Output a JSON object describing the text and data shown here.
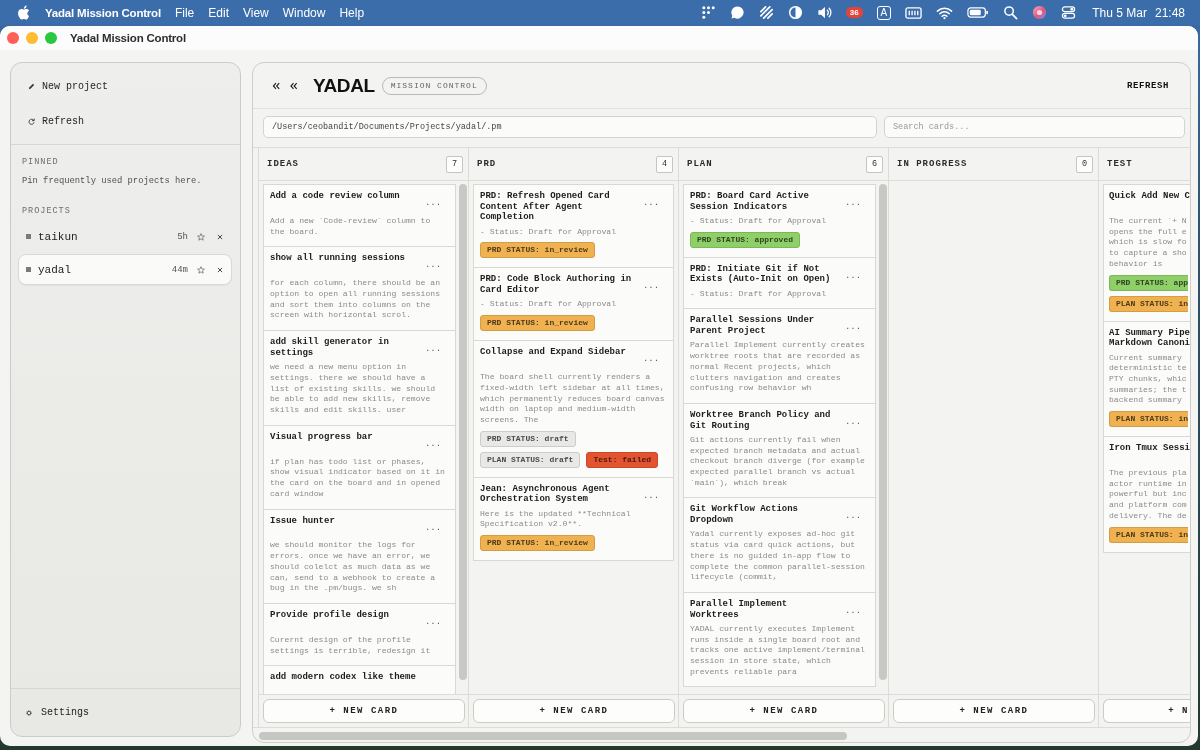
{
  "menubar": {
    "app": "Yadal Mission Control",
    "menus": [
      "File",
      "Edit",
      "View",
      "Window",
      "Help"
    ],
    "notification_count": "36",
    "input_source": "A",
    "date": "Thu 5 Mar",
    "time": "21:48"
  },
  "window": {
    "title": "Yadal Mission Control"
  },
  "sidebar": {
    "actions": [
      {
        "kind": "new",
        "label": "New project"
      },
      {
        "kind": "refresh",
        "label": "Refresh"
      }
    ],
    "pinned": {
      "heading": "PINNED",
      "empty_text": "Pin frequently used projects here."
    },
    "projects": {
      "heading": "PROJECTS",
      "items": [
        {
          "name": "taikun",
          "age": "5h",
          "starred": false,
          "selected": false
        },
        {
          "name": "yadal",
          "age": "44m",
          "starred": false,
          "selected": true
        }
      ]
    },
    "settings": "Settings"
  },
  "header": {
    "logo": "YADAL",
    "badge": "MISSION CONTROL",
    "refresh": "REFRESH",
    "path": {
      "value": "/Users/ceobandit/Documents/Projects/yadal/.pm"
    },
    "search": {
      "placeholder": "Search cards..."
    }
  },
  "columns": [
    {
      "title": "IDEAS",
      "count": "7",
      "scrollable": true,
      "new_card": "+ NEW CARD",
      "cards": [
        {
          "title": "Add a code review column",
          "menu": "...",
          "body": "Add a new `Code-review` column to the board."
        },
        {
          "title": "show all running sessions",
          "menu": "...",
          "body": "for each column, there should be an option to open all running sessions and sort them into columns on the screen with horizontal scrol."
        },
        {
          "title": "add skill generator in settings",
          "menu": "...",
          "body": "we need a new menu option in settings. there we should have a list of existing skills. we should be able to add new skills, remove skills and edit skills. user"
        },
        {
          "title": "Visual progress bar",
          "menu": "...",
          "body": "if plan has todo list or phases, show visual indicator based on it in the card on the board and in opened card window"
        },
        {
          "title": "Issue hunter",
          "menu": "...",
          "body": "we should monitor the logs for errors. once we have an error, we should colelct as much data as we can, send to a webhook to create a bug in the .pm/bugs. we sh"
        },
        {
          "title": "Provide profile design",
          "menu": "...",
          "body": "Curernt design of the profile settings is terrible, redesign it"
        },
        {
          "title": "add modern codex like theme"
        }
      ]
    },
    {
      "title": "PRD",
      "count": "4",
      "scrollable": false,
      "new_card": "+ NEW CARD",
      "cards": [
        {
          "title": "PRD: Refresh Opened Card Content After Agent Completion",
          "menu": "...",
          "body": "- Status: Draft for Approval",
          "badges": [
            {
              "text": "PRD STATUS: in_review",
              "color": "#f0b250"
            }
          ]
        },
        {
          "title": "PRD: Code Block Authoring in Card Editor",
          "menu": "...",
          "body": "- Status: Draft for Approval",
          "badges": [
            {
              "text": "PRD STATUS: in_review",
              "color": "#f0b250"
            }
          ]
        },
        {
          "title": "Collapse and Expand Sidebar",
          "menu": "...",
          "body": "The board shell currently renders a fixed-width left sidebar at all times, which permanently reduces board canvas width on laptop and medium-width screens. The",
          "badges": [
            {
              "text": "PRD STATUS: draft",
              "color": "#e8e8e6"
            },
            {
              "text": "PLAN STATUS: draft",
              "color": "#e8e8e6"
            },
            {
              "text": "Test: failed",
              "color": "#e3532f"
            }
          ]
        },
        {
          "title": "Jean: Asynchronous Agent Orchestration System",
          "menu": "...",
          "body": "Here is the updated **Technical Specification v2.0**.",
          "badges": [
            {
              "text": "PRD STATUS: in_review",
              "color": "#f0b250"
            }
          ]
        }
      ]
    },
    {
      "title": "PLAN",
      "count": "6",
      "scrollable": true,
      "new_card": "+ NEW CARD",
      "cards": [
        {
          "title": "PRD: Board Card Active Session Indicators",
          "menu": "...",
          "body": "- Status: Draft for Approval",
          "badges": [
            {
              "text": "PRD STATUS: approved",
              "color": "#8fcf68"
            }
          ]
        },
        {
          "title": "PRD: Initiate Git if Not Exists (Auto-Init on Open)",
          "menu": "...",
          "body": "- Status: Draft for Approval"
        },
        {
          "title": "Parallel Sessions Under Parent Project",
          "menu": "...",
          "body": "Parallel Implement currently creates worktree roots that are recorded as normal Recent projects, which clutters navigation and creates confusing row behavior wh"
        },
        {
          "title": "Worktree Branch Policy and Git Routing",
          "menu": "...",
          "body": "Git actions currently fail when expected branch metadata and actual checkout branch diverge (for example expected parallel branch vs actual `main`), which break"
        },
        {
          "title": "Git Workflow Actions Dropdown",
          "menu": "...",
          "body": "Yadal currently exposes ad-hoc git status via card quick actions, but there is no guided in-app flow to complete the common parallel-session lifecycle (commit,"
        },
        {
          "title": "Parallel Implement Worktrees",
          "menu": "...",
          "body": "YADAL currently executes Implement runs inside a single board root and tracks one active implement/terminal session in store state, which prevents reliable para"
        }
      ]
    },
    {
      "title": "IN PROGRESS",
      "count": "0",
      "scrollable": false,
      "new_card": "+ NEW CARD"
    },
    {
      "title": "TEST",
      "scrollable": false,
      "new_card": "+ N",
      "cards": [
        {
          "title": "Quick Add New C",
          "body": "The current `+ N\nopens the full e\nwhich is slow fo\nto capture a sho\nbehavior is",
          "badges": [
            {
              "text": "PRD STATUS: app",
              "color": "#8fcf68"
            },
            {
              "text": "PLAN STATUS: in",
              "color": "#f0b250"
            }
          ]
        },
        {
          "title": "AI Summary Pipe\nMarkdown Canoni",
          "body": "Current summary\ndeterministic te\nPTY chunks, whic\nsummaries; the t\nbackend summary",
          "badges": [
            {
              "text": "PLAN STATUS: in",
              "color": "#f0b250"
            }
          ]
        },
        {
          "title": "Iron Tmux Sessi",
          "body": "The previous pla\nactor runtime in\npowerful but inc\nand platform com\ndelivery. The de",
          "badges": [
            {
              "text": "PLAN STATUS: in",
              "color": "#f0b250"
            }
          ]
        }
      ]
    }
  ]
}
